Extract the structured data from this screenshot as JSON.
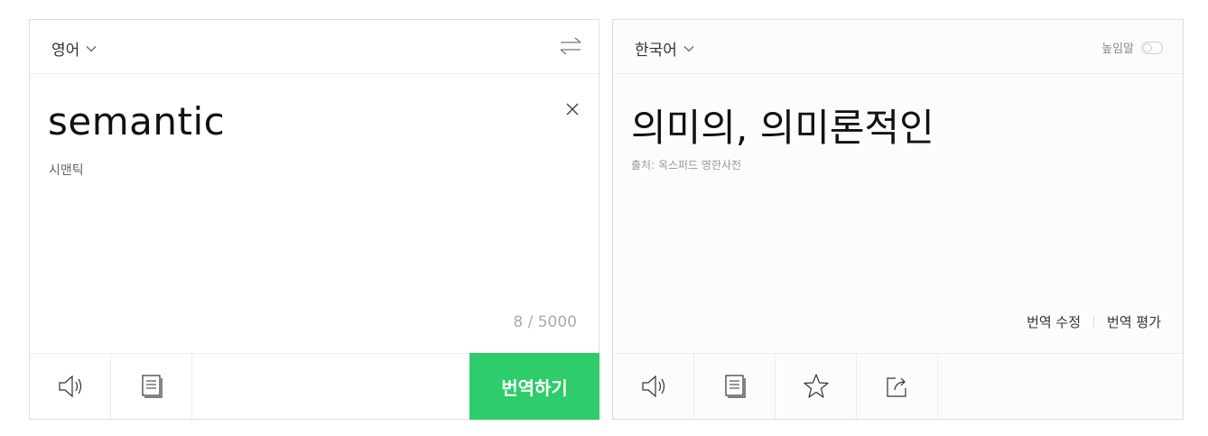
{
  "source_panel": {
    "language": "영어",
    "input_text": "semantic",
    "pronunciation": "시맨틱",
    "char_count": "8 / 5000",
    "translate_button": "번역하기"
  },
  "target_panel": {
    "language": "한국어",
    "honorific_label": "높임말",
    "honorific_enabled": false,
    "result_text": "의미의, 의미론적인",
    "source_note": "출처: 옥스퍼드 영한사전",
    "edit_link": "번역 수정",
    "rate_link": "번역 평가"
  },
  "colors": {
    "accent": "#2ecc6a",
    "border": "#dcdcdc"
  },
  "icons": {
    "source_footer": [
      "speaker-icon",
      "copy-icon"
    ],
    "target_footer": [
      "speaker-icon",
      "copy-icon",
      "star-icon",
      "share-icon"
    ]
  }
}
